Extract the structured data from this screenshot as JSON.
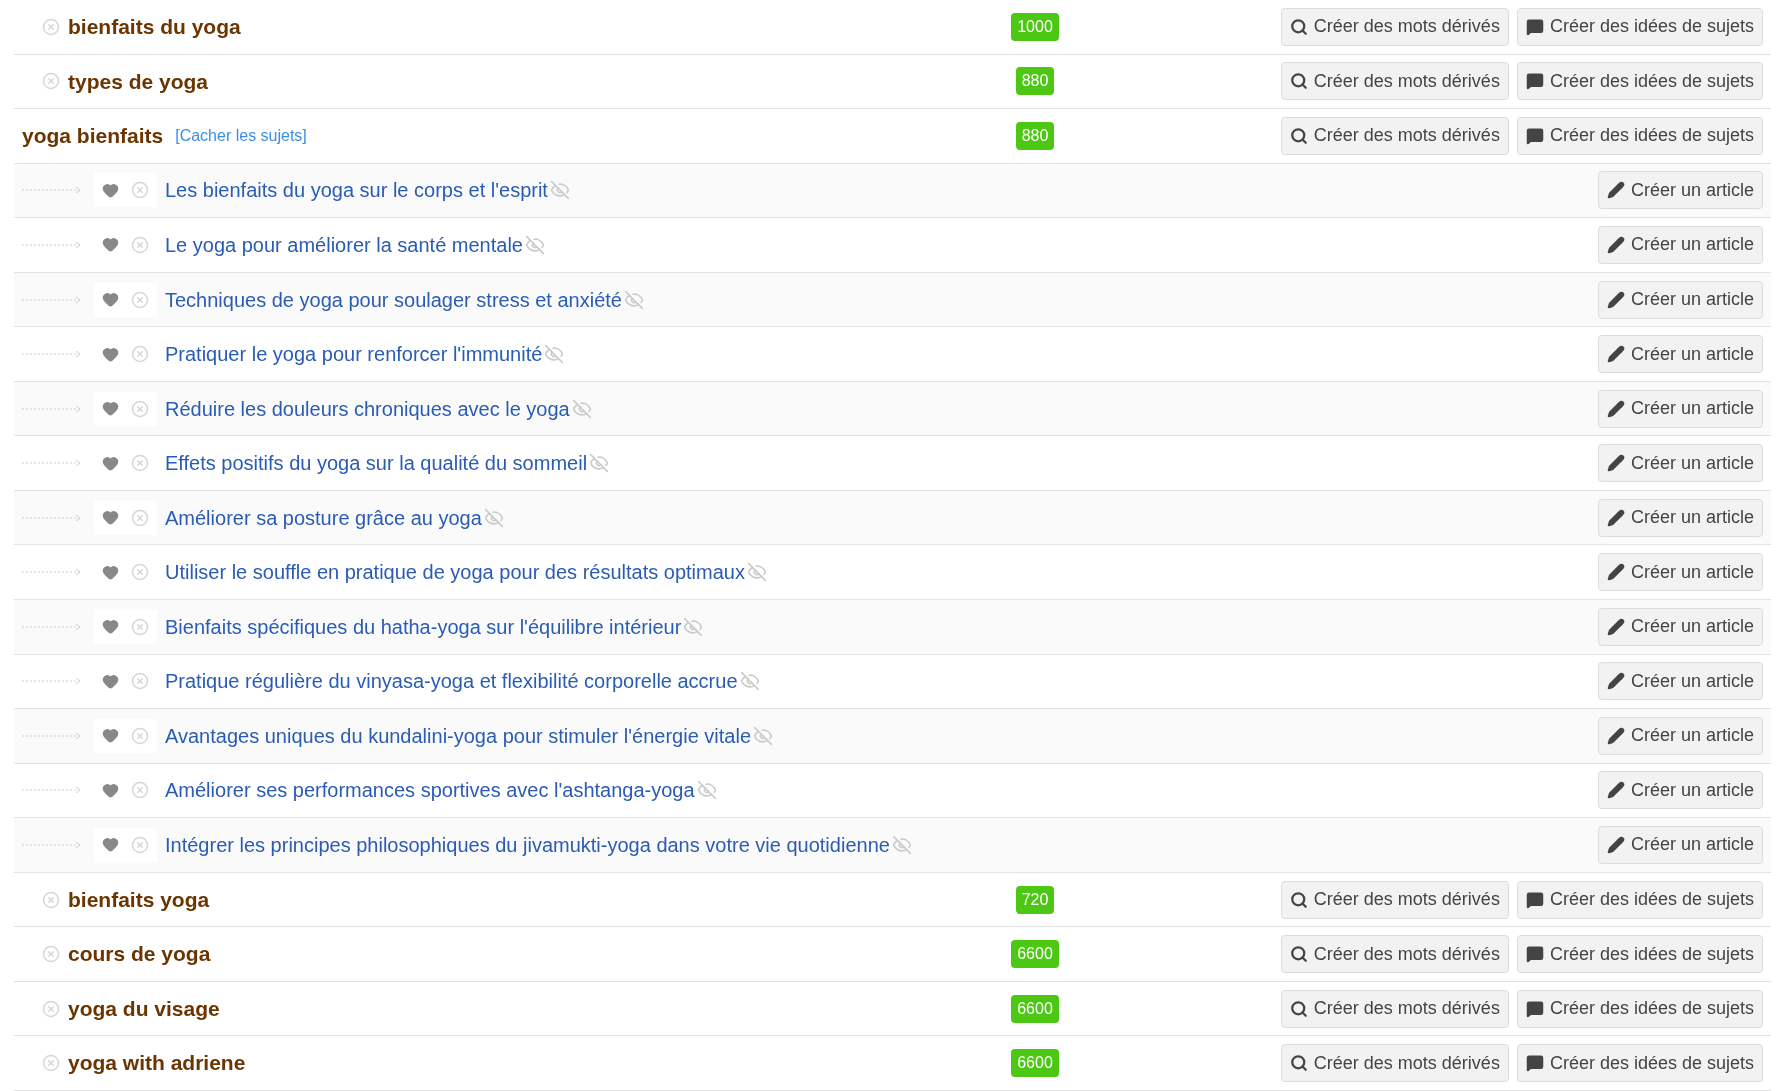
{
  "keywords": [
    {
      "keyword": "bienfaits du yoga",
      "volume": "1000",
      "expanded": false,
      "buttons": [
        "Créer des mots dérivés",
        "Créer des idées de sujets"
      ]
    },
    {
      "keyword": "types de yoga",
      "volume": "880",
      "expanded": false,
      "buttons": [
        "Créer des mots dérivés",
        "Créer des idées de sujets"
      ]
    },
    {
      "keyword": "yoga bienfaits",
      "volume": "880",
      "expanded": true,
      "toggle_link": "[Cacher les sujets]",
      "buttons": [
        "Créer des mots dérivés",
        "Créer des idées de sujets"
      ],
      "topics": [
        {
          "title": "Les bienfaits du yoga sur le corps et l'esprit",
          "button": "Créer un article"
        },
        {
          "title": "Le yoga pour améliorer la santé mentale",
          "button": "Créer un article"
        },
        {
          "title": "Techniques de yoga pour soulager stress et anxiété",
          "button": "Créer un article"
        },
        {
          "title": "Pratiquer le yoga pour renforcer l'immunité",
          "button": "Créer un article"
        },
        {
          "title": "Réduire les douleurs chroniques avec le yoga",
          "button": "Créer un article"
        },
        {
          "title": "Effets positifs du yoga sur la qualité du sommeil",
          "button": "Créer un article"
        },
        {
          "title": "Améliorer sa posture grâce au yoga",
          "button": "Créer un article"
        },
        {
          "title": "Utiliser le souffle en pratique de yoga pour des résultats optimaux",
          "button": "Créer un article"
        },
        {
          "title": "Bienfaits spécifiques du hatha-yoga sur l'équilibre intérieur",
          "button": "Créer un article"
        },
        {
          "title": "Pratique régulière du vinyasa-yoga et flexibilité corporelle accrue",
          "button": "Créer un article"
        },
        {
          "title": "Avantages uniques du kundalini-yoga pour stimuler l'énergie vitale",
          "button": "Créer un article"
        },
        {
          "title": "Améliorer ses performances sportives avec l'ashtanga-yoga",
          "button": "Créer un article"
        },
        {
          "title": "Intégrer les principes philosophiques du jivamukti-yoga dans votre vie quotidienne",
          "button": "Créer un article"
        }
      ]
    },
    {
      "keyword": "bienfaits yoga",
      "volume": "720",
      "expanded": false,
      "buttons": [
        "Créer des mots dérivés",
        "Créer des idées de sujets"
      ]
    },
    {
      "keyword": "cours de yoga",
      "volume": "6600",
      "expanded": false,
      "buttons": [
        "Créer des mots dérivés",
        "Créer des idées de sujets"
      ]
    },
    {
      "keyword": "yoga du visage",
      "volume": "6600",
      "expanded": false,
      "buttons": [
        "Créer des mots dérivés",
        "Créer des idées de sujets"
      ]
    },
    {
      "keyword": "yoga with adriene",
      "volume": "6600",
      "expanded": false,
      "buttons": [
        "Créer des mots dérivés",
        "Créer des idées de sujets"
      ]
    }
  ]
}
